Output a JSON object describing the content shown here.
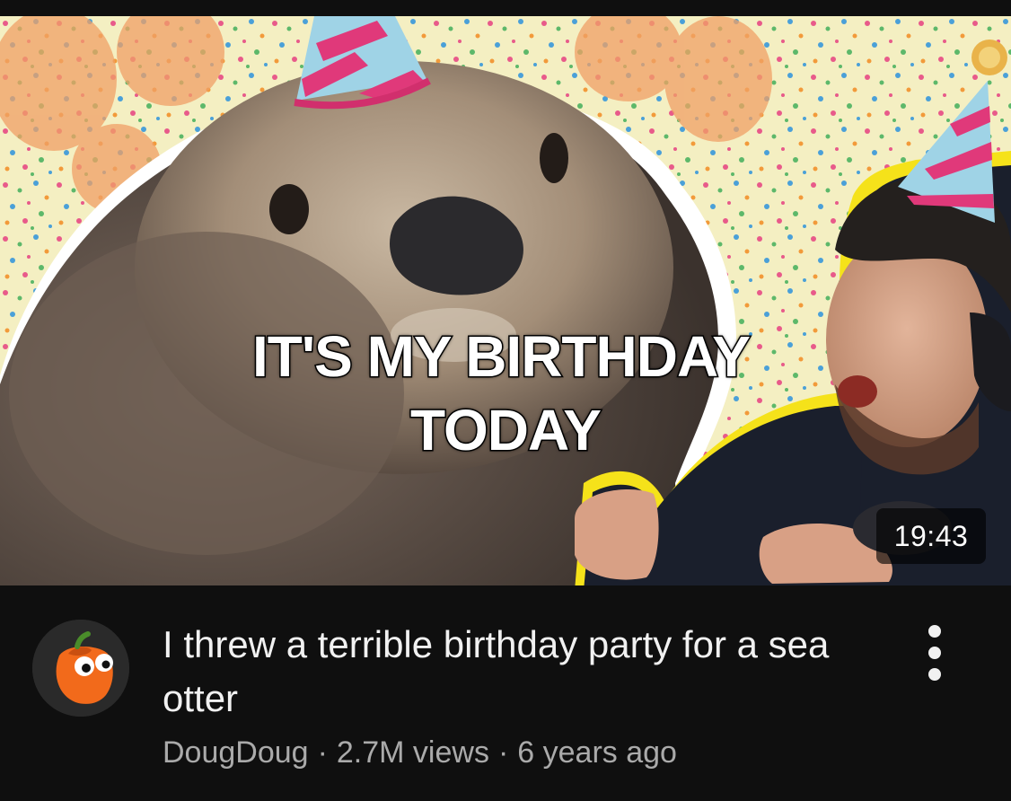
{
  "video": {
    "thumbnail": {
      "caption_line1": "IT'S MY BIRTHDAY",
      "caption_line2": "TODAY",
      "duration": "19:43"
    },
    "title": "I threw a terrible birthday party for a sea otter",
    "channel": "DougDoug",
    "separator": "·",
    "views": "2.7M views",
    "age": "6 years ago",
    "avatar_icon": "bell-pepper-avatar-icon",
    "more_icon": "more-vertical-icon"
  },
  "colors": {
    "background": "#0f0f0f",
    "title_text": "#f1f1f1",
    "meta_text": "#aaaaaa",
    "outline_yellow": "#f5e21a",
    "party_hat_pink": "#e0397a",
    "party_hat_blue": "#9fd3e6",
    "avatar_orange": "#f26a1b"
  }
}
